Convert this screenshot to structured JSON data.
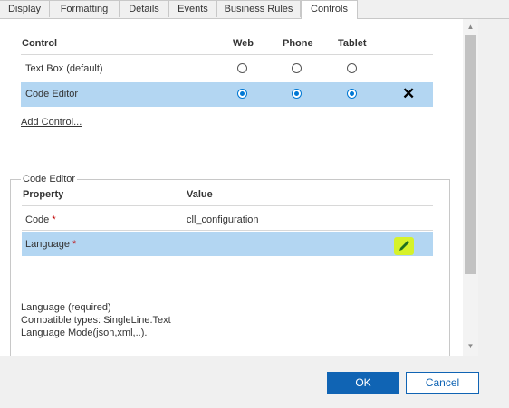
{
  "tabs": [
    "Display",
    "Formatting",
    "Details",
    "Events",
    "Business Rules",
    "Controls"
  ],
  "controls_table": {
    "headers": {
      "control": "Control",
      "web": "Web",
      "phone": "Phone",
      "tablet": "Tablet"
    },
    "rows": [
      {
        "label": "Text Box (default)",
        "web": false,
        "phone": false,
        "tablet": false,
        "selected": false
      },
      {
        "label": "Code Editor",
        "web": true,
        "phone": true,
        "tablet": true,
        "selected": true
      }
    ],
    "add_control_label": "Add Control..."
  },
  "properties_panel": {
    "legend": "Code Editor",
    "headers": {
      "property": "Property",
      "value": "Value"
    },
    "rows": [
      {
        "property": "Code",
        "required_mark": "*",
        "value": "cll_configuration"
      },
      {
        "property": "Language",
        "required_mark": "*",
        "value": ""
      }
    ],
    "description_lines": [
      "Language (required)",
      "Compatible types: SingleLine.Text",
      "Language Mode(json,xml,..)."
    ]
  },
  "footer": {
    "ok_label": "OK",
    "cancel_label": "Cancel"
  },
  "colors": {
    "accent": "#0078d4",
    "selected_row": "#b3d6f2",
    "highlight": "#d6f22a",
    "required": "#c00000"
  }
}
